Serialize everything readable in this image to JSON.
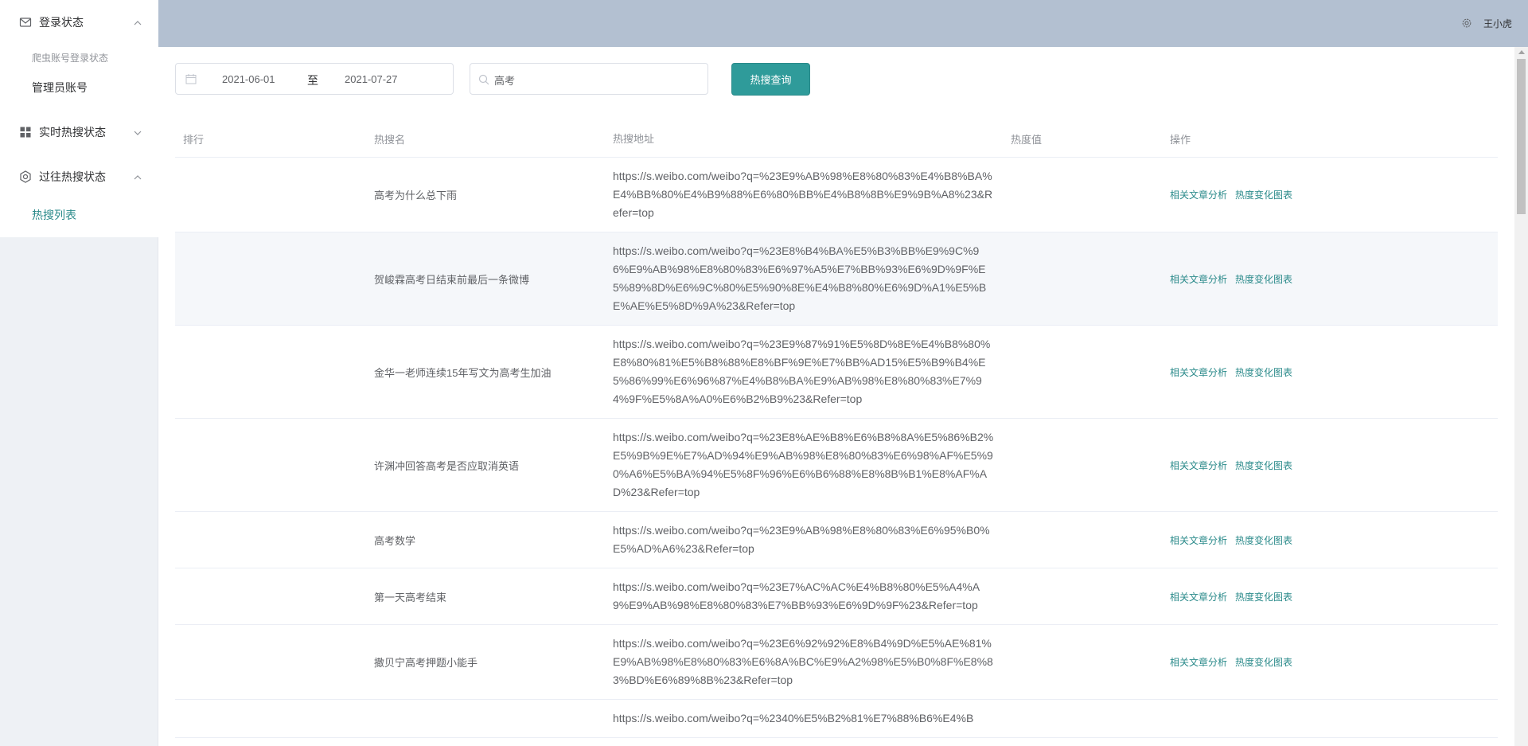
{
  "sidebar": {
    "groups": [
      {
        "label": "登录状态",
        "icon": "mail-icon",
        "expanded": true,
        "items": [
          {
            "label": "爬虫账号登录状态",
            "style": "small"
          },
          {
            "label": "管理员账号",
            "style": "big"
          }
        ]
      },
      {
        "label": "实时热搜状态",
        "icon": "grid-icon",
        "expanded": false,
        "items": []
      },
      {
        "label": "过往热搜状态",
        "icon": "gear-icon",
        "expanded": true,
        "items": [
          {
            "label": "热搜列表",
            "active": true
          }
        ]
      }
    ]
  },
  "header": {
    "username": "王小虎",
    "gear_icon": "gear-icon"
  },
  "toolbar": {
    "date_start": "2021-06-01",
    "date_separator": "至",
    "date_end": "2021-07-27",
    "search_value": "高考",
    "search_button": "热搜查询"
  },
  "table": {
    "columns": [
      "排行",
      "热搜名",
      "热搜地址",
      "热度值",
      "操作"
    ],
    "action_labels": [
      "相关文章分析",
      "热度变化图表"
    ],
    "rows": [
      {
        "rank": "",
        "name": "高考为什么总下雨",
        "url": "https://s.weibo.com/weibo?q=%23E9%AB%98%E8%80%83%E4%B8%BA%E4%BB%80%E4%B9%88%E6%80%BB%E4%B8%8B%E9%9B%A8%23&Refer=top",
        "heat": ""
      },
      {
        "rank": "",
        "name": "贺峻霖高考日结束前最后一条微博",
        "url": "https://s.weibo.com/weibo?q=%23E8%B4%BA%E5%B3%BB%E9%9C%96%E9%AB%98%E8%80%83%E6%97%A5%E7%BB%93%E6%9D%9F%E5%89%8D%E6%9C%80%E5%90%8E%E4%B8%80%E6%9D%A1%E5%BE%AE%E5%8D%9A%23&Refer=top",
        "heat": ""
      },
      {
        "rank": "",
        "name": "金华一老师连续15年写文为高考生加油",
        "url": "https://s.weibo.com/weibo?q=%23E9%87%91%E5%8D%8E%E4%B8%80%E8%80%81%E5%B8%88%E8%BF%9E%E7%BB%AD15%E5%B9%B4%E5%86%99%E6%96%87%E4%B8%BA%E9%AB%98%E8%80%83%E7%94%9F%E5%8A%A0%E6%B2%B9%23&Refer=top",
        "heat": ""
      },
      {
        "rank": "",
        "name": "许渊冲回答高考是否应取消英语",
        "url": "https://s.weibo.com/weibo?q=%23E8%AE%B8%E6%B8%8A%E5%86%B2%E5%9B%9E%E7%AD%94%E9%AB%98%E8%80%83%E6%98%AF%E5%90%A6%E5%BA%94%E5%8F%96%E6%B6%88%E8%8B%B1%E8%AF%AD%23&Refer=top",
        "heat": ""
      },
      {
        "rank": "",
        "name": "高考数学",
        "url": "https://s.weibo.com/weibo?q=%23E9%AB%98%E8%80%83%E6%95%B0%E5%AD%A6%23&Refer=top",
        "heat": ""
      },
      {
        "rank": "",
        "name": "第一天高考结束",
        "url": "https://s.weibo.com/weibo?q=%23E7%AC%AC%E4%B8%80%E5%A4%A9%E9%AB%98%E8%80%83%E7%BB%93%E6%9D%9F%23&Refer=top",
        "heat": ""
      },
      {
        "rank": "",
        "name": "撒贝宁高考押题小能手",
        "url": "https://s.weibo.com/weibo?q=%23E6%92%92%E8%B4%9D%E5%AE%81%E9%AB%98%E8%80%83%E6%8A%BC%E9%A2%98%E5%B0%8F%E8%83%BD%E6%89%8B%23&Refer=top",
        "heat": ""
      },
      {
        "rank": "",
        "name": "",
        "url": "https://s.weibo.com/weibo?q=%2340%E5%B2%81%E7%88%B6%E4%B",
        "heat": ""
      }
    ]
  }
}
